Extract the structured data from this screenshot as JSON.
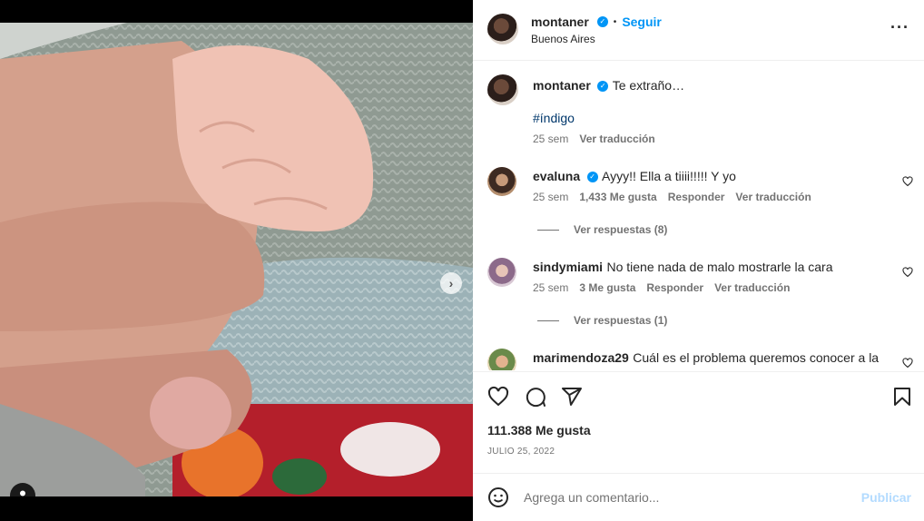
{
  "post": {
    "username": "montaner",
    "follow_label": "Seguir",
    "separator": "•",
    "location": "Buenos Aires",
    "more_icon": "more-horizontal-icon",
    "caption": "Te extraño…",
    "hashtag": "#índigo",
    "caption_time": "25 sem",
    "see_translation": "Ver traducción",
    "likes": "111.388 Me gusta",
    "date": "JULIO 25, 2022"
  },
  "media": {
    "carousel_total": 2,
    "carousel_active": 1
  },
  "comments": [
    {
      "username": "evaluna",
      "verified": true,
      "text": "Ayyy!! Ella a tiiii!!!!! Y yo",
      "time": "25 sem",
      "likes": "1,433 Me gusta",
      "reply": "Responder",
      "translate": "Ver traducción",
      "replies": "Ver respuestas (8)"
    },
    {
      "username": "sindymiami",
      "verified": false,
      "text": "No tiene nada de malo mostrarle la cara",
      "time": "25 sem",
      "likes": "3 Me gusta",
      "reply": "Responder",
      "translate": "Ver traducción",
      "replies": "Ver respuestas (1)"
    },
    {
      "username": "marimendoza29",
      "verified": false,
      "text": "Cuál es el problema queremos conocer a la"
    }
  ],
  "composer": {
    "placeholder": "Agrega un comentario...",
    "publish": "Publicar"
  },
  "colors": {
    "accent": "#0095f6",
    "publish_disabled": "#b3dbff",
    "muted": "#737373"
  }
}
